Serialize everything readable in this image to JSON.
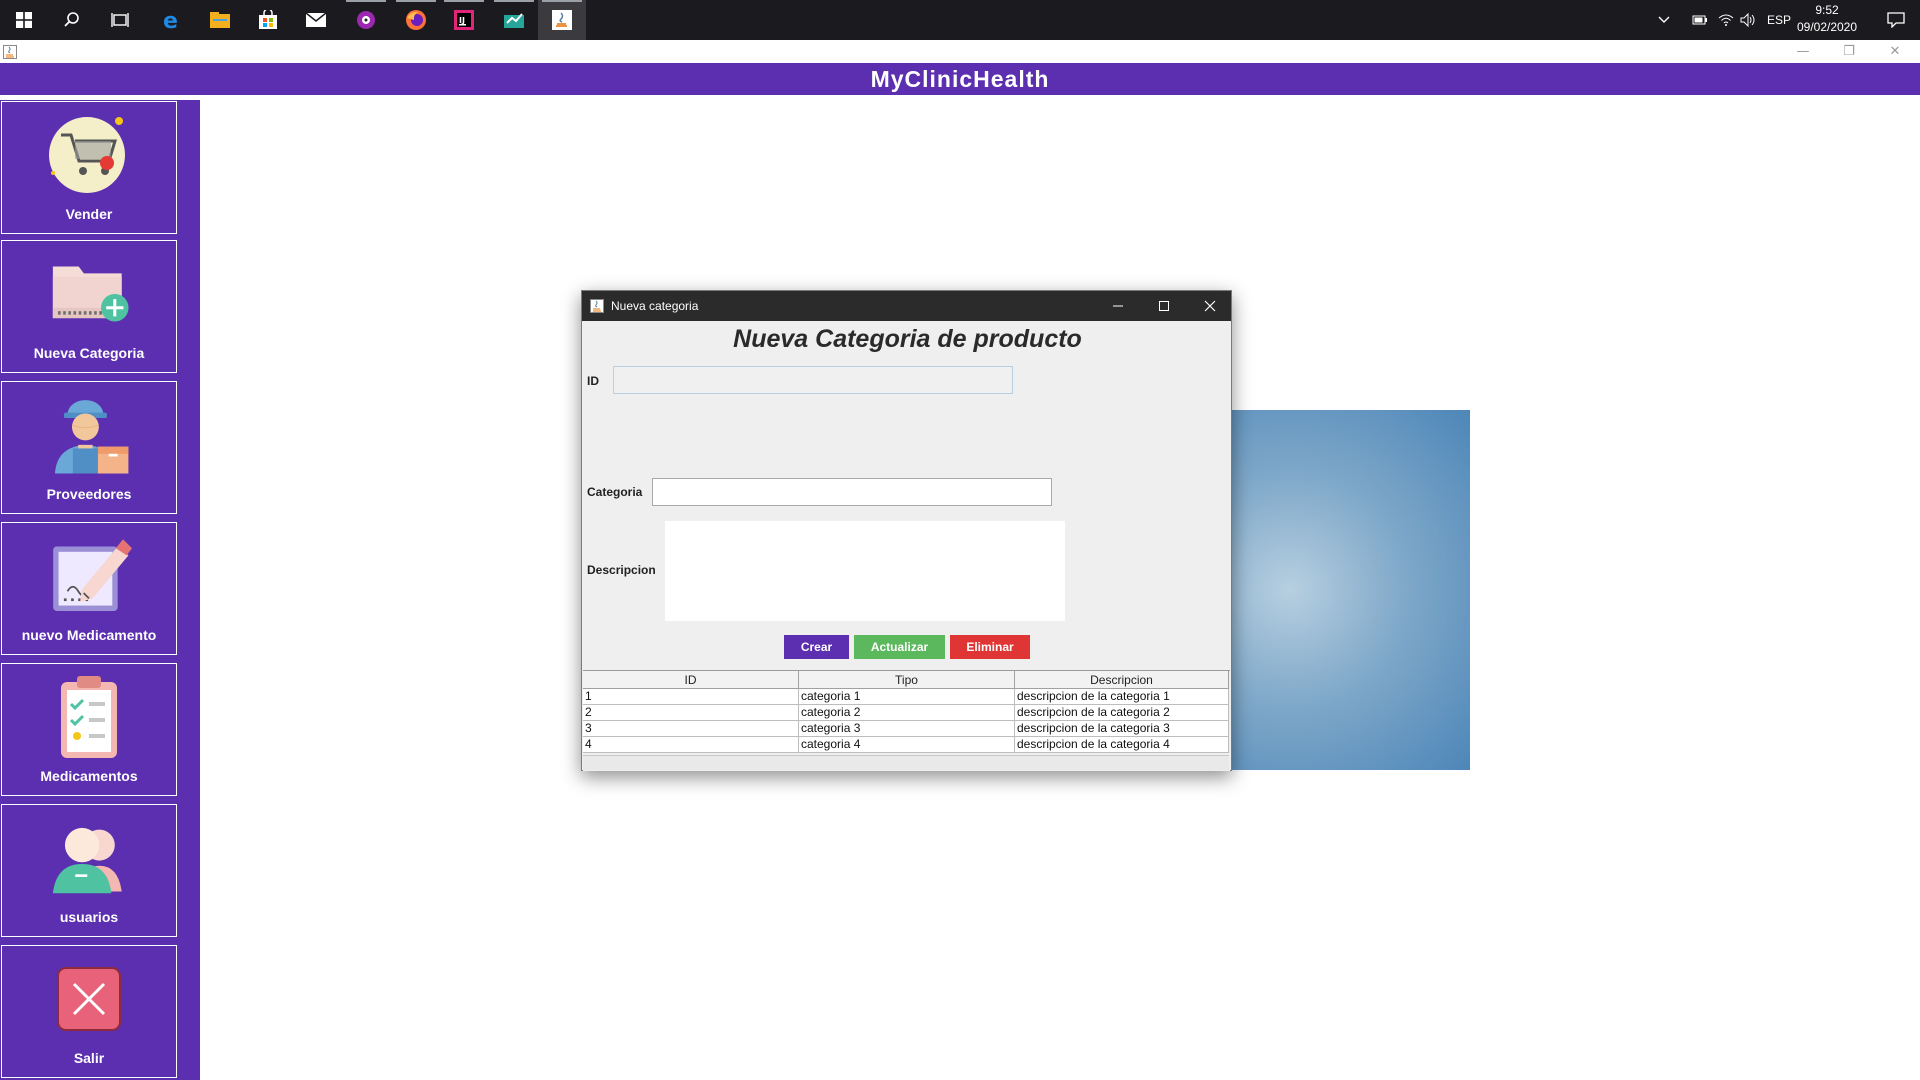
{
  "taskbar": {
    "apps": [
      {
        "icon": "windows-start-icon",
        "active": false
      },
      {
        "icon": "search-icon",
        "active": false
      },
      {
        "icon": "task-view-icon",
        "active": false
      },
      {
        "icon": "edge-browser-icon",
        "active": false
      },
      {
        "icon": "file-explorer-icon",
        "active": false
      },
      {
        "icon": "store-icon",
        "active": false
      },
      {
        "icon": "mail-icon",
        "active": false
      },
      {
        "icon": "media-player-icon",
        "active": true
      },
      {
        "icon": "firefox-icon",
        "active": true
      },
      {
        "icon": "intellij-icon",
        "active": true
      },
      {
        "icon": "app-icon",
        "active": true
      },
      {
        "icon": "java-icon",
        "active": true
      }
    ],
    "language": "ESP",
    "time": "9:52",
    "date": "09/02/2020"
  },
  "app": {
    "title": "MyClinicHealth",
    "brand_color": "#5b2fb0"
  },
  "sidebar": {
    "items": [
      {
        "label": "Vender",
        "icon": "shopping-cart-icon"
      },
      {
        "label": "Nueva Categoria",
        "icon": "folder-add-icon"
      },
      {
        "label": "Proveedores",
        "icon": "delivery-person-icon"
      },
      {
        "label": "nuevo Medicamento",
        "icon": "edit-document-icon"
      },
      {
        "label": "Medicamentos",
        "icon": "checklist-clipboard-icon"
      },
      {
        "label": "usuarios",
        "icon": "users-icon"
      },
      {
        "label": "Salir",
        "icon": "exit-icon"
      }
    ]
  },
  "dialog": {
    "title": "Nueva categoria",
    "heading": "Nueva Categoria de producto",
    "id_label": "ID",
    "id_value": "",
    "categoria_label": "Categoria",
    "categoria_value": "",
    "descripcion_label": "Descripcion",
    "descripcion_value": "",
    "buttons": {
      "crear": {
        "label": "Crear",
        "color": "#5b2fb0"
      },
      "actualizar": {
        "label": "Actualizar",
        "color": "#5cb85c"
      },
      "eliminar": {
        "label": "Eliminar",
        "color": "#e03535"
      }
    },
    "table": {
      "columns": [
        "ID",
        "Tipo",
        "Descripcion"
      ],
      "rows": [
        [
          "1",
          "categoria 1",
          "descripcion de la categoria 1"
        ],
        [
          "2",
          "categoria 2",
          "descripcion de la categoria 2"
        ],
        [
          "3",
          "categoria 3",
          "descripcion de la categoria 3"
        ],
        [
          "4",
          "categoria 4",
          "descripcion de la categoria 4"
        ]
      ]
    }
  }
}
